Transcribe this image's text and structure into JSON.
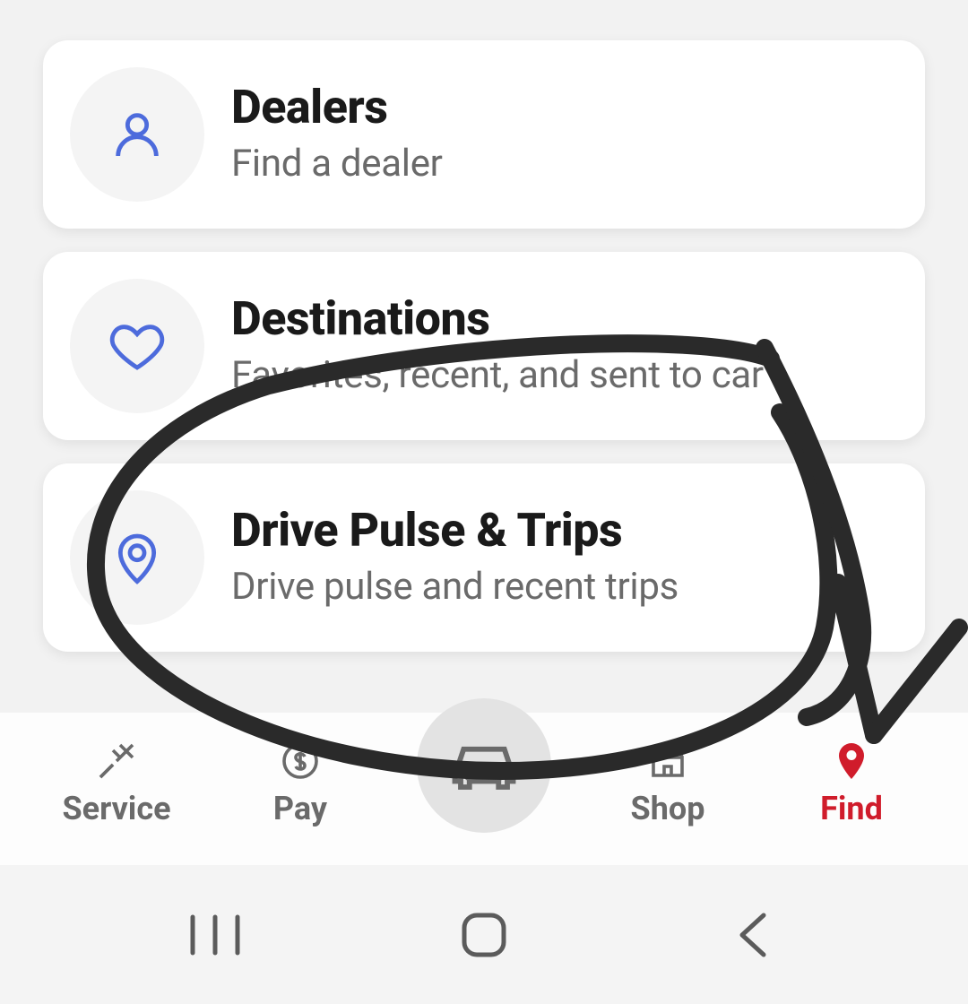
{
  "cards": [
    {
      "id": "dealers",
      "icon": "user-icon",
      "title": "Dealers",
      "subtitle": "Find a dealer"
    },
    {
      "id": "destinations",
      "icon": "heart-icon",
      "title": "Destinations",
      "subtitle": "Favorites, recent, and sent to car"
    },
    {
      "id": "drive-pulse",
      "icon": "map-pin-icon",
      "title": "Drive Pulse & Trips",
      "subtitle": "Drive pulse and recent trips"
    }
  ],
  "tabs": {
    "service": {
      "label": "Service",
      "active": false
    },
    "pay": {
      "label": "Pay",
      "active": false
    },
    "vehicle": {
      "label": "",
      "active": false
    },
    "shop": {
      "label": "Shop",
      "active": false
    },
    "find": {
      "label": "Find",
      "active": true
    }
  },
  "colors": {
    "card_icon_stroke": "#4d6bdc",
    "tab_inactive": "#6a6a6a",
    "tab_active": "#d01c2b"
  }
}
